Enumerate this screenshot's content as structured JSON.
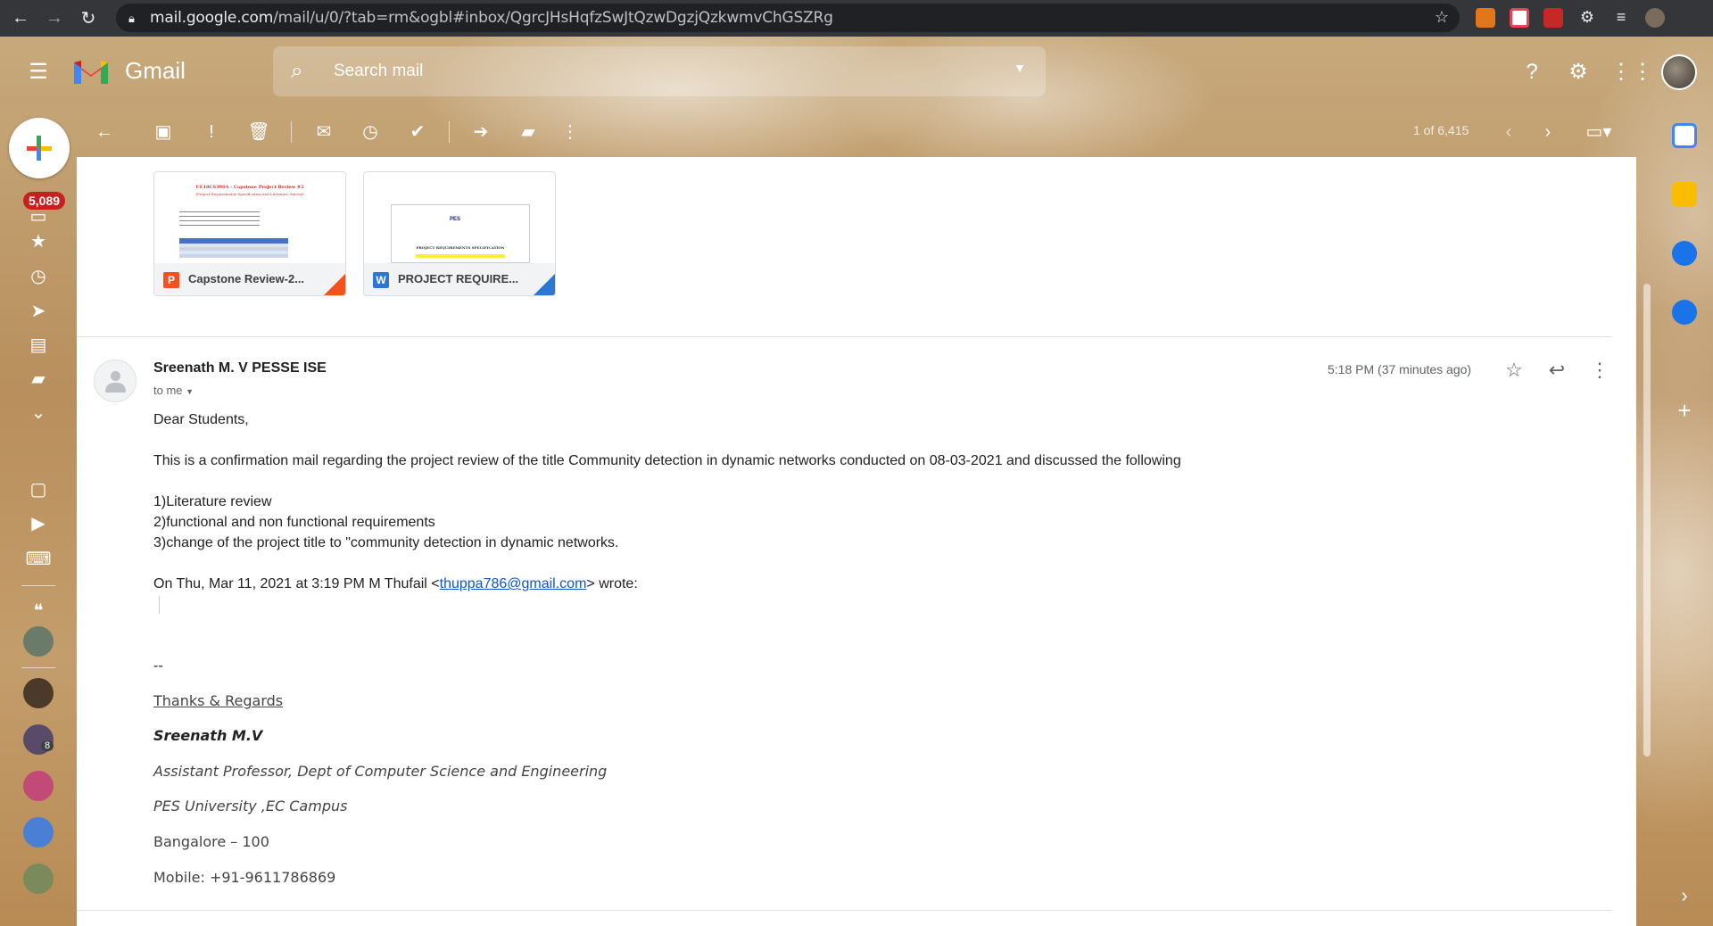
{
  "browser": {
    "url_host": "mail.google.com",
    "url_path": "/mail/u/0/?tab=rm&ogbl#inbox/QgrcJHsHqfzSwJtQzwDgzjQzkwmvChGSZRg"
  },
  "header": {
    "app_name": "Gmail",
    "search_placeholder": "Search mail"
  },
  "sidebar": {
    "unread_count": "5,089",
    "chat_badge": "8"
  },
  "toolbar": {
    "pager": "1 of 6,415"
  },
  "attachments": [
    {
      "type_letter": "P",
      "name": "Capstone Review-2...",
      "thumb_title": "UE18CS390A - Capstone Project Review #2",
      "thumb_subtitle": "(Project Requirements Specification and Literature Survey)",
      "color": "#f4511e"
    },
    {
      "type_letter": "W",
      "name": "PROJECT REQUIRE...",
      "thumb_title": "PROJECT REQUIREMENTS SPECIFICATION",
      "thumb_logo": "PES",
      "color": "#2a77d4"
    }
  ],
  "message": {
    "sender": "Sreenath M. V PESSE ISE",
    "to": "to me",
    "time": "5:18 PM (37 minutes ago)",
    "greeting": "Dear Students,",
    "para1": "This is a confirmation mail regarding the project review of  the title Community detection in dynamic networks conducted on 08-03-2021 and discussed the following",
    "items": [
      "1)Literature review",
      "2)functional and non functional requirements",
      "3)change of the project title to \"community detection in dynamic networks."
    ],
    "quote_prefix": "On Thu, Mar 11, 2021 at 3:19 PM M Thufail <",
    "quote_email": "thuppa786@gmail.com",
    "quote_suffix": "> wrote:",
    "sig_dash": "--",
    "sig_thanks": "Thanks & Regards",
    "sig_name": "Sreenath M.V",
    "sig_title": "Assistant Professor, Dept of  Computer Science and Engineering",
    "sig_univ": "PES University ,EC Campus",
    "sig_city": "Bangalore – 100",
    "sig_mobile": "Mobile: +91-9611786869"
  }
}
